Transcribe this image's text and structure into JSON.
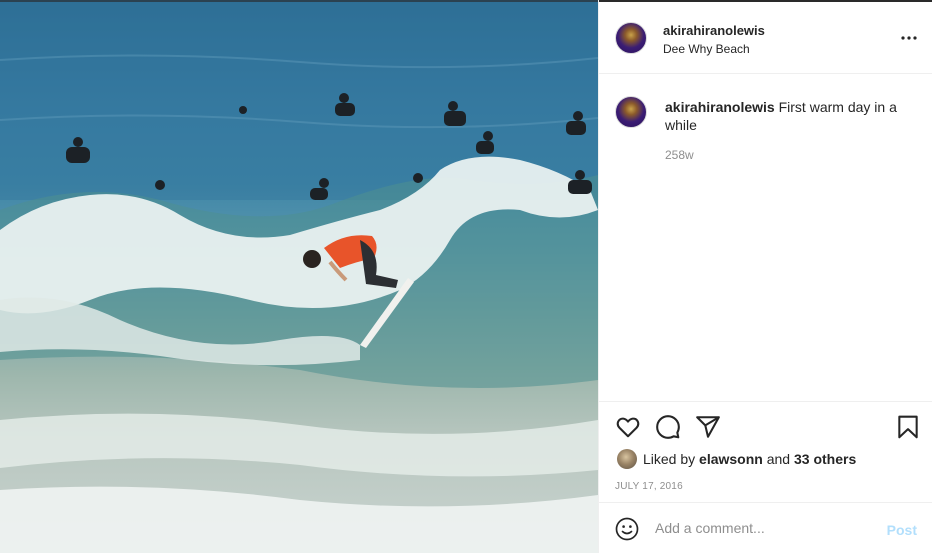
{
  "post": {
    "author": "akirahiranolewis",
    "location": "Dee Why Beach",
    "caption": "First warm day in a while",
    "time_ago": "258w",
    "liked_by_prefix": "Liked by",
    "liked_by_user": "elawsonn",
    "liked_by_and": "and",
    "liked_by_others": "33 others",
    "date": "JULY 17, 2016"
  },
  "comment_box": {
    "placeholder": "Add a comment...",
    "post_label": "Post"
  },
  "icons": {
    "more": "more-options-icon",
    "like": "heart-icon",
    "comment": "comment-icon",
    "share": "share-icon",
    "save": "bookmark-icon",
    "emoji": "emoji-icon"
  },
  "colors": {
    "accent_post_disabled": "#b2dffc",
    "muted_text": "#8e8e8e",
    "primary_text": "#262626"
  }
}
